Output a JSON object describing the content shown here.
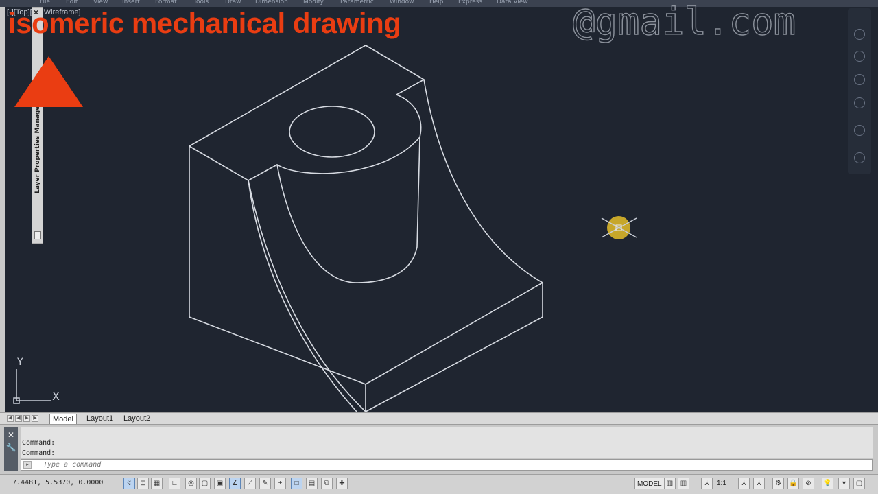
{
  "menu": {
    "items": [
      "File",
      "Edit",
      "View",
      "Insert",
      "Format",
      "Tools",
      "Draw",
      "Dimension",
      "Modify",
      "Parametric",
      "Window",
      "Help",
      "Express",
      "Data View"
    ]
  },
  "viewport_label": "[-][Top][2D Wireframe]",
  "watermark": "@gmail.com",
  "headline": "isomeric mechanical drawing",
  "palette": {
    "title": "Layer Properties Manager",
    "close": "×"
  },
  "ucs": {
    "y_label": "Y",
    "x_label": "X"
  },
  "layout_tabs": [
    "Model",
    "Layout1",
    "Layout2"
  ],
  "command": {
    "history": [
      "Command:",
      "Command:"
    ],
    "placeholder": "Type a command"
  },
  "status": {
    "coordinates": "7.4481, 5.5370, 0.0000",
    "model_label": "MODEL",
    "scale": "1:1"
  },
  "colors": {
    "background": "#1f2530",
    "linework": "#d7dbe2",
    "headline": "#ea3d12",
    "cursor_highlight": "#d9b62a"
  }
}
